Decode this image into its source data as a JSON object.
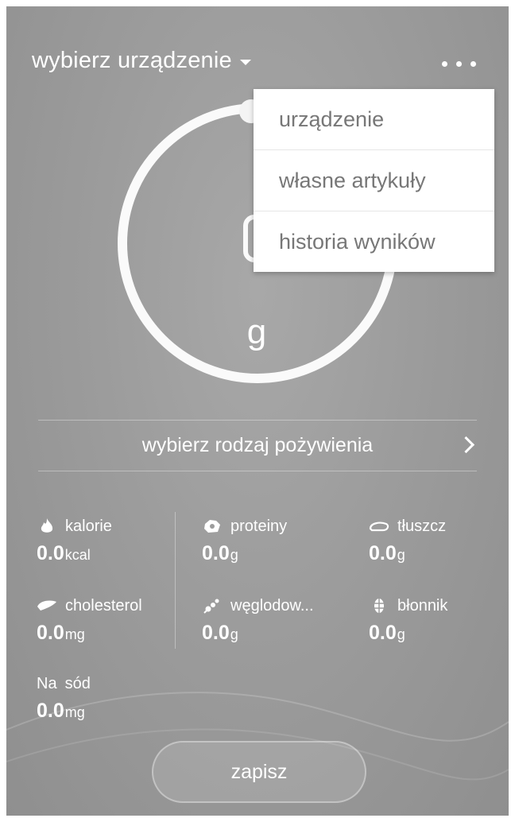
{
  "header": {
    "device_select_label": "wybierz urządzenie"
  },
  "menu": {
    "items": [
      {
        "label": "urządzenie"
      },
      {
        "label": "własne artykuły"
      },
      {
        "label": "historia wyników"
      }
    ]
  },
  "scale": {
    "unit": "g"
  },
  "food_type": {
    "label": "wybierz rodzaj pożywienia"
  },
  "nutrients": [
    {
      "label": "kalorie",
      "value": "0.0",
      "unit": "kcal",
      "icon": "flame-icon"
    },
    {
      "label": "proteiny",
      "value": "0.0",
      "unit": "g",
      "icon": "protein-icon"
    },
    {
      "label": "tłuszcz",
      "value": "0.0",
      "unit": "g",
      "icon": "fat-icon"
    },
    {
      "label": "cholesterol",
      "value": "0.0",
      "unit": "mg",
      "icon": "liver-icon"
    },
    {
      "label": "węglodow...",
      "value": "0.0",
      "unit": "g",
      "icon": "carb-icon"
    },
    {
      "label": "błonnik",
      "value": "0.0",
      "unit": "g",
      "icon": "fiber-icon"
    },
    {
      "label": "sód",
      "icon_text": "Na",
      "value": "0.0",
      "unit": "mg",
      "icon": "sodium-icon"
    }
  ],
  "save_button": {
    "label": "zapisz"
  }
}
